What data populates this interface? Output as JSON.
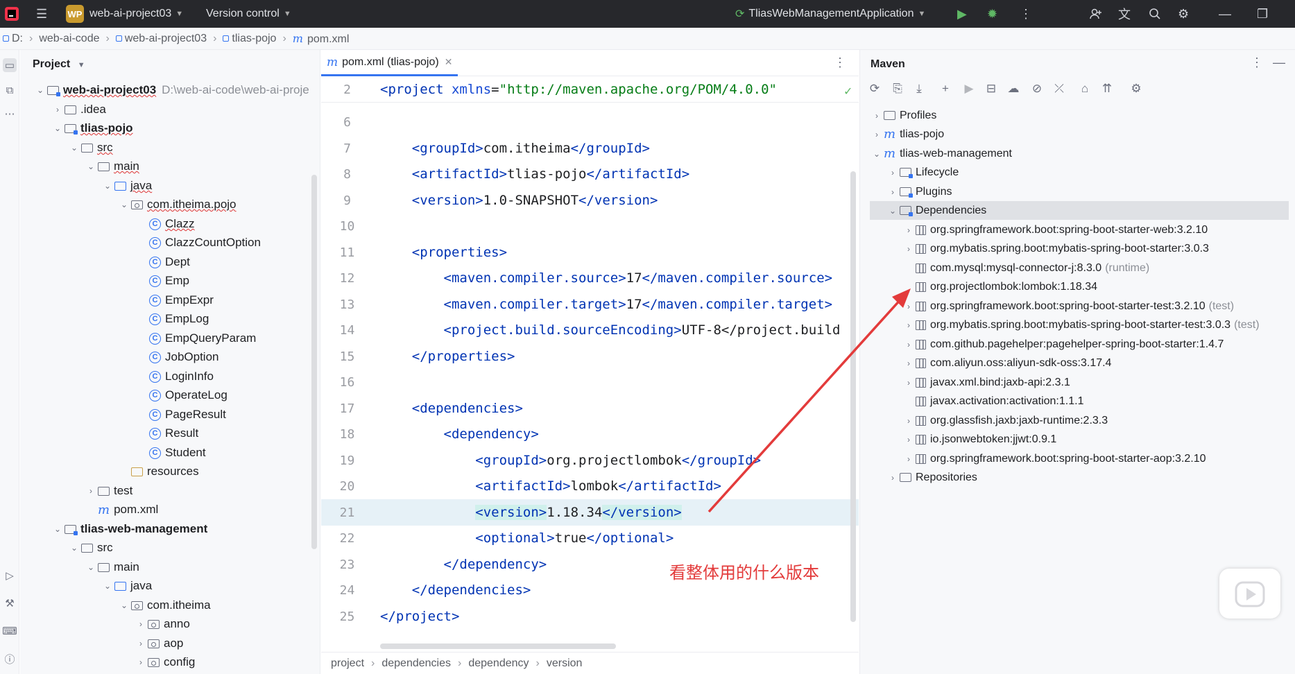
{
  "titlebar": {
    "badge": "WP",
    "project": "web-ai-project03",
    "vcs": "Version control",
    "run_config": "TliasWebManagementApplication"
  },
  "breadcrumb": [
    "D:",
    "web-ai-code",
    "web-ai-project03",
    "tlias-pojo",
    "pom.xml"
  ],
  "project_panel": {
    "title": "Project",
    "root_path": "D:\\web-ai-code\\web-ai-proje",
    "tree": [
      {
        "label": "web-ai-project03",
        "icon": "module-folder",
        "expanded": true
      },
      {
        "label": ".idea",
        "icon": "folder",
        "expanded": false
      },
      {
        "label": "tlias-pojo",
        "icon": "module-folder",
        "expanded": true
      },
      {
        "label": "src",
        "icon": "folder",
        "expanded": true
      },
      {
        "label": "main",
        "icon": "folder",
        "expanded": true
      },
      {
        "label": "java",
        "icon": "source-folder",
        "expanded": true
      },
      {
        "label": "com.itheima.pojo",
        "icon": "package",
        "expanded": true
      },
      {
        "label": "Clazz",
        "icon": "class"
      },
      {
        "label": "ClazzCountOption",
        "icon": "class"
      },
      {
        "label": "Dept",
        "icon": "class"
      },
      {
        "label": "Emp",
        "icon": "class"
      },
      {
        "label": "EmpExpr",
        "icon": "class"
      },
      {
        "label": "EmpLog",
        "icon": "class"
      },
      {
        "label": "EmpQueryParam",
        "icon": "class"
      },
      {
        "label": "JobOption",
        "icon": "class"
      },
      {
        "label": "LoginInfo",
        "icon": "class"
      },
      {
        "label": "OperateLog",
        "icon": "class"
      },
      {
        "label": "PageResult",
        "icon": "class"
      },
      {
        "label": "Result",
        "icon": "class"
      },
      {
        "label": "Student",
        "icon": "class"
      },
      {
        "label": "resources",
        "icon": "resources-folder"
      },
      {
        "label": "test",
        "icon": "folder",
        "expanded": false
      },
      {
        "label": "pom.xml",
        "icon": "maven-file"
      },
      {
        "label": "tlias-web-management",
        "icon": "module-folder",
        "expanded": true
      },
      {
        "label": "src",
        "icon": "folder",
        "expanded": true
      },
      {
        "label": "main",
        "icon": "folder",
        "expanded": true
      },
      {
        "label": "java",
        "icon": "source-folder",
        "expanded": true
      },
      {
        "label": "com.itheima",
        "icon": "package",
        "expanded": true
      },
      {
        "label": "anno",
        "icon": "package",
        "expanded": false
      },
      {
        "label": "aop",
        "icon": "package",
        "expanded": false
      },
      {
        "label": "config",
        "icon": "package",
        "expanded": false
      }
    ]
  },
  "editor": {
    "tab": "pom.xml (tlias-pojo)",
    "lines": [
      {
        "n": "2",
        "t": "<project xmlns=\"http://maven.apache.org/POM/4.0.0\""
      },
      {
        "n": "6",
        "t": ""
      },
      {
        "n": "7",
        "t": "    <groupId>com.itheima</groupId>"
      },
      {
        "n": "8",
        "t": "    <artifactId>tlias-pojo</artifactId>"
      },
      {
        "n": "9",
        "t": "    <version>1.0-SNAPSHOT</version>"
      },
      {
        "n": "10",
        "t": ""
      },
      {
        "n": "11",
        "t": "    <properties>"
      },
      {
        "n": "12",
        "t": "        <maven.compiler.source>17</maven.compiler.source>"
      },
      {
        "n": "13",
        "t": "        <maven.compiler.target>17</maven.compiler.target>"
      },
      {
        "n": "14",
        "t": "        <project.build.sourceEncoding>UTF-8</project.build"
      },
      {
        "n": "15",
        "t": "    </properties>"
      },
      {
        "n": "16",
        "t": ""
      },
      {
        "n": "17",
        "t": "    <dependencies>"
      },
      {
        "n": "18",
        "t": "        <dependency>"
      },
      {
        "n": "19",
        "t": "            <groupId>org.projectlombok</groupId>"
      },
      {
        "n": "20",
        "t": "            <artifactId>lombok</artifactId>"
      },
      {
        "n": "21",
        "t": "            <version>1.18.34</version>"
      },
      {
        "n": "22",
        "t": "            <optional>true</optional>"
      },
      {
        "n": "23",
        "t": "        </dependency>"
      },
      {
        "n": "24",
        "t": "    </dependencies>"
      },
      {
        "n": "25",
        "t": "</project>"
      }
    ],
    "current_line": "21",
    "crumbs": [
      "project",
      "dependencies",
      "dependency",
      "version"
    ]
  },
  "maven": {
    "title": "Maven",
    "tree": [
      {
        "label": "Profiles",
        "icon": "folder",
        "expanded": false
      },
      {
        "label": "tlias-pojo",
        "icon": "maven",
        "expanded": false
      },
      {
        "label": "tlias-web-management",
        "icon": "maven",
        "expanded": true
      },
      {
        "label": "Lifecycle",
        "icon": "config-folder",
        "expanded": false
      },
      {
        "label": "Plugins",
        "icon": "config-folder",
        "expanded": false
      },
      {
        "label": "Dependencies",
        "icon": "config-folder",
        "expanded": true
      },
      {
        "label": "org.springframework.boot:spring-boot-starter-web:3.2.10",
        "icon": "library",
        "expandable": true
      },
      {
        "label": "org.mybatis.spring.boot:mybatis-spring-boot-starter:3.0.3",
        "icon": "library",
        "expandable": true
      },
      {
        "label": "com.mysql:mysql-connector-j:8.3.0",
        "scope": "(runtime)",
        "icon": "library",
        "expandable": false
      },
      {
        "label": "org.projectlombok:lombok:1.18.34",
        "icon": "library",
        "expandable": false
      },
      {
        "label": "org.springframework.boot:spring-boot-starter-test:3.2.10",
        "scope": "(test)",
        "icon": "library",
        "expandable": true
      },
      {
        "label": "org.mybatis.spring.boot:mybatis-spring-boot-starter-test:3.0.3",
        "scope": "(test)",
        "icon": "library",
        "expandable": true
      },
      {
        "label": "com.github.pagehelper:pagehelper-spring-boot-starter:1.4.7",
        "icon": "library",
        "expandable": true
      },
      {
        "label": "com.aliyun.oss:aliyun-sdk-oss:3.17.4",
        "icon": "library",
        "expandable": true
      },
      {
        "label": "javax.xml.bind:jaxb-api:2.3.1",
        "icon": "library",
        "expandable": true
      },
      {
        "label": "javax.activation:activation:1.1.1",
        "icon": "library",
        "expandable": false
      },
      {
        "label": "org.glassfish.jaxb:jaxb-runtime:2.3.3",
        "icon": "library",
        "expandable": true
      },
      {
        "label": "io.jsonwebtoken:jjwt:0.9.1",
        "icon": "library",
        "expandable": true
      },
      {
        "label": "org.springframework.boot:spring-boot-starter-aop:3.2.10",
        "icon": "library",
        "expandable": true
      },
      {
        "label": "Repositories",
        "icon": "folder",
        "expanded": false
      }
    ]
  },
  "annotation": {
    "text": "看整体用的什么版本",
    "color": "#e33b3b"
  },
  "colors": {
    "accent": "#3574f0",
    "xml_tag": "#0033b3",
    "xml_string": "#067d17",
    "annotation_red": "#e33b3b"
  }
}
